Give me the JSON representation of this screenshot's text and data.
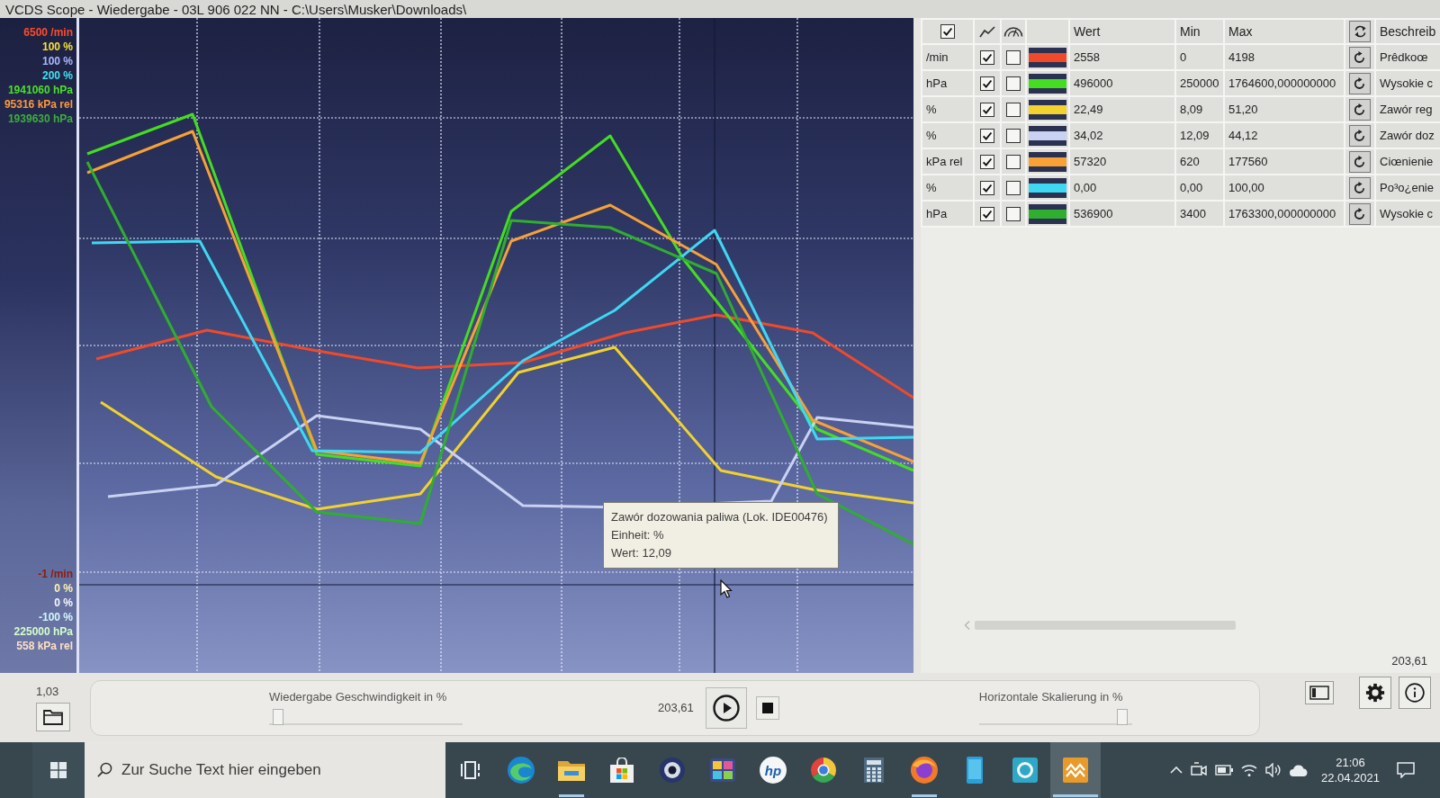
{
  "window": {
    "title": "VCDS Scope - Wiedergabe - 03L 906 022 NN - C:\\Users\\Musker\\Downloads\\"
  },
  "scope": {
    "scale_top": [
      {
        "text": "6500 /min",
        "color": "#ff4b2b"
      },
      {
        "text": "100 %",
        "color": "#f6e03a"
      },
      {
        "text": "100 %",
        "color": "#aab8ff"
      },
      {
        "text": "200 %",
        "color": "#42e2f2"
      },
      {
        "text": "1941060 hPa",
        "color": "#4ae02a"
      },
      {
        "text": "95316 kPa rel",
        "color": "#ff9a3c"
      },
      {
        "text": "1939630 hPa",
        "color": "#3cae3c"
      }
    ],
    "scale_bottom": [
      {
        "text": "-1 /min",
        "color": "#8c1c10"
      },
      {
        "text": "0 %",
        "color": "#fff3b0"
      },
      {
        "text": "0 %",
        "color": "#f6f8ff"
      },
      {
        "text": "-100 %",
        "color": "#d2f8fb"
      },
      {
        "text": "225000 hPa",
        "color": "#d4ffc8"
      },
      {
        "text": "558 kPa rel",
        "color": "#ffe0c4"
      }
    ],
    "tooltip": {
      "lines": [
        "Zawór dozowania paliwa (Lok. IDE00476)",
        "Einheit: %",
        "Wert: 12,09"
      ]
    }
  },
  "table": {
    "all_checked": true,
    "columns": [
      "Wert",
      "Min",
      "Max",
      "Beschreib"
    ],
    "rows": [
      {
        "unit": "/min",
        "plot": true,
        "gauge": false,
        "color": "#f04a2a",
        "value": "2558",
        "min": "0",
        "max": "4198",
        "description": "Prêdkoœ"
      },
      {
        "unit": "hPa",
        "plot": true,
        "gauge": false,
        "color": "#44dd22",
        "value": "496000",
        "min": "250000",
        "max": "1764600,000000000",
        "description": "Wysokie c"
      },
      {
        "unit": "%",
        "plot": true,
        "gauge": false,
        "color": "#f2d22e",
        "value": "22,49",
        "min": "8,09",
        "max": "51,20",
        "description": "Zawór reg"
      },
      {
        "unit": "%",
        "plot": true,
        "gauge": false,
        "color": "#c9d2f2",
        "value": "34,02",
        "min": "12,09",
        "max": "44,12",
        "description": "Zawór doz"
      },
      {
        "unit": "kPa rel",
        "plot": true,
        "gauge": false,
        "color": "#f7a136",
        "value": "57320",
        "min": "620",
        "max": "177560",
        "description": "Ciœnienie"
      },
      {
        "unit": "%",
        "plot": true,
        "gauge": false,
        "color": "#3fd8f2",
        "value": "0,00",
        "min": "0,00",
        "max": "100,00",
        "description": "Po³o¿enie"
      },
      {
        "unit": "hPa",
        "plot": true,
        "gauge": false,
        "color": "#2fae2f",
        "value": "536900",
        "min": "3400",
        "max": "1763300,000000000",
        "description": "Wysokie c"
      }
    ]
  },
  "end_time": "203,61",
  "playback": {
    "start_time": "1,03",
    "speed_label": "Wiedergabe Geschwindigkeit in %",
    "speed": {
      "level": 0.02
    },
    "time": "203,61",
    "scale_label": "Horizontale Skalierung in %",
    "scale": {
      "level": 0.97
    }
  },
  "taskbar": {
    "search_placeholder": "Zur Suche Text hier eingeben",
    "apps": [
      {
        "kind": "taskview",
        "running": false,
        "selected": false
      },
      {
        "kind": "swirl",
        "running": false,
        "selected": false
      },
      {
        "kind": "folder",
        "running": true,
        "selected": false
      },
      {
        "kind": "bag",
        "running": false,
        "selected": false
      },
      {
        "kind": "webcam",
        "running": false,
        "selected": false
      },
      {
        "kind": "tiles",
        "running": false,
        "selected": false
      },
      {
        "kind": "logo",
        "label": "hp",
        "running": false,
        "selected": false
      },
      {
        "kind": "ring",
        "running": false,
        "selected": false
      },
      {
        "kind": "calculator",
        "running": false,
        "selected": false
      },
      {
        "kind": "globe",
        "running": true,
        "selected": false
      },
      {
        "kind": "phone",
        "running": false,
        "selected": false
      },
      {
        "kind": "lens",
        "running": false,
        "selected": false
      },
      {
        "kind": "wave",
        "running": true,
        "selected": true
      }
    ],
    "time": "21:06",
    "date": "22.04.2021"
  }
}
